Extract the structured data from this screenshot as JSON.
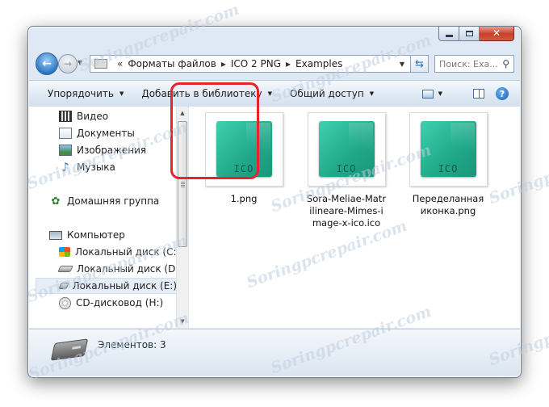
{
  "window": {
    "address": {
      "crumbs": [
        "Форматы файлов",
        "ICO 2 PNG",
        "Examples"
      ]
    },
    "search": {
      "placeholder": "Поиск: Exa..."
    }
  },
  "toolbar": {
    "organize": "Упорядочить",
    "add_to_library": "Добавить в библиотеку",
    "share": "Общий доступ"
  },
  "nav": {
    "items": [
      {
        "label": "Видео",
        "icon": "video-icon"
      },
      {
        "label": "Документы",
        "icon": "documents-icon"
      },
      {
        "label": "Изображения",
        "icon": "pictures-icon"
      },
      {
        "label": "Музыка",
        "icon": "music-icon"
      },
      {
        "label": "Домашняя группа",
        "icon": "homegroup-icon"
      },
      {
        "label": "Компьютер",
        "icon": "computer-icon"
      },
      {
        "label": "Локальный диск (C:)",
        "icon": "windows-drive-icon"
      },
      {
        "label": "Локальный диск (D:)",
        "icon": "drive-icon"
      },
      {
        "label": "Локальный диск (E:)",
        "icon": "drive-icon",
        "selected": true
      },
      {
        "label": "CD-дисковод (H:)",
        "icon": "cd-drive-icon"
      }
    ]
  },
  "files": [
    {
      "name": "1.png",
      "icon_text": "ICO",
      "highlighted": true
    },
    {
      "name": "Sora-Meliae-Matrilineare-Mimes-image-x-ico.ico",
      "name_lines": [
        "Sora-Meliae-Matr",
        "ilineare-Mimes-i",
        "mage-x-ico.ico"
      ],
      "icon_text": "ICO"
    },
    {
      "name": "Переделанная иконка.png",
      "name_lines": [
        "Переделанная",
        "иконка.png"
      ],
      "icon_text": "ICO"
    }
  ],
  "status": {
    "text": "Элементов: 3"
  },
  "watermark": "Soringpcrepair.com",
  "colors": {
    "highlight": "#e8232a",
    "icon_teal": "#20a889"
  }
}
